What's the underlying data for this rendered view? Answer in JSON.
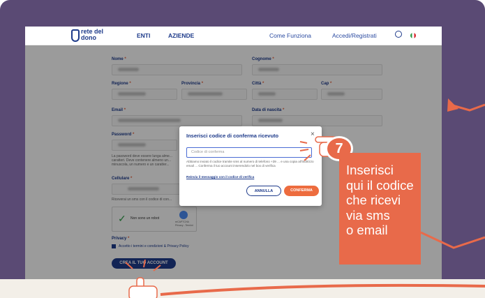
{
  "nav": {
    "logo_text": "rete del dono",
    "items": [
      "ENTI",
      "AZIENDE"
    ],
    "how_it_works": "Come Funziona",
    "login": "Accedi/Registrati"
  },
  "form": {
    "nome": "Nome",
    "cognome": "Cognome",
    "regione": "Regione",
    "provincia": "Provincia",
    "citta": "Città",
    "cap": "Cap",
    "email": "Email",
    "data_nascita": "Data di nascita",
    "password": "Password",
    "password_note": "La password deve essere lunga alme... caratteri. Deve contenere almeno un... minuscola, un numero e un caratter...",
    "cellulare": "Cellulare",
    "sms_note": "Riceverai un sms con il codice di con...",
    "captcha_label": "Non sono un robot",
    "captcha_brand": "reCAPTCHA",
    "captcha_links": "Privacy - Termini",
    "privacy": "Privacy",
    "accept": "Accetto i termini e condizioni & Privacy Policy",
    "create_button": "CREA IL TUO ACCOUNT"
  },
  "modal": {
    "title": "Inserisci codice di conferma ricevuto",
    "input_placeholder": "Codice di conferma",
    "message": "Abbiamo inviato il codice tramite sms al numero di telefono +39 ... e una copia all'indirizzo email ... Conferma il tuo account inserendolo nel box di verifica",
    "resend": "Reinvia il messaggio con il codice di verifica",
    "cancel": "ANNULLA",
    "confirm": "CONFERMA"
  },
  "callout": {
    "step": "7",
    "text": "Inserisci\nqui il codice\nche ricevi\nvia sms\no email"
  },
  "colors": {
    "frame": "#5a4a74",
    "accent": "#e86a4a",
    "primary": "#1d3a8a"
  }
}
